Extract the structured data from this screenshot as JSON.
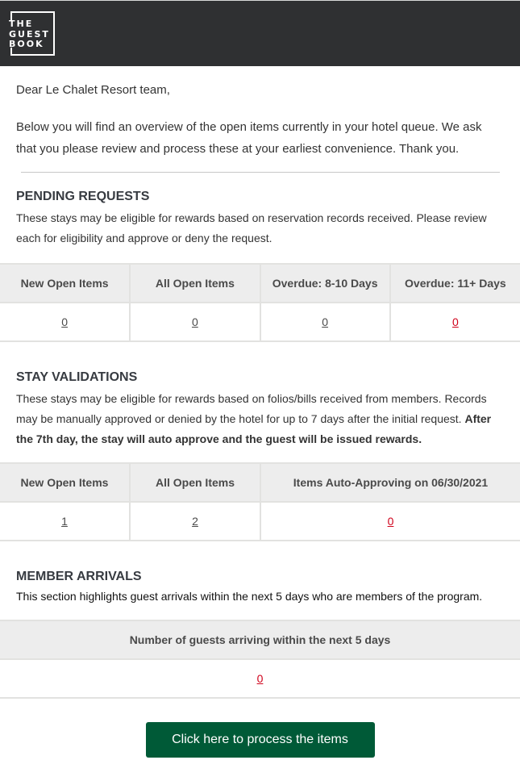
{
  "header": {
    "logo_lines": [
      "THE",
      "GUEST",
      "BOOK"
    ],
    "background": "#2f3032"
  },
  "letter": {
    "greeting": "Dear Le Chalet Resort team,",
    "intro": "Below you will find an overview of the open items currently in your hotel queue. We ask that you please review and process these at your earliest convenience. Thank you."
  },
  "pending_requests": {
    "title": "PENDING REQUESTS",
    "description": "These stays may be eligible for rewards based on reservation records received. Please review each for eligibility and approve or deny the request.",
    "columns": [
      "New Open Items",
      "All Open Items",
      "Overdue: 8-10 Days",
      "Overdue: 11+ Days"
    ],
    "values": [
      "0",
      "0",
      "0",
      "0"
    ]
  },
  "stay_validations": {
    "title": "STAY VALIDATIONS",
    "description": "These stays may be eligible for rewards based on folios/bills received from members. Records may be manually approved or denied by the hotel for up to 7 days after the initial request. ",
    "description_bold": "After the 7th day, the stay will auto approve and the guest will be issued rewards.",
    "columns": [
      "New Open Items",
      "All Open Items",
      "Items Auto-Approving on 06/30/2021"
    ],
    "values": [
      "1",
      "2",
      "0"
    ]
  },
  "member_arrivals": {
    "title": "MEMBER ARRIVALS",
    "description": "This section highlights guest arrivals within the next 5 days who are members of the program.",
    "columns": [
      "Number of guests arriving within the next 5 days"
    ],
    "values": [
      "0"
    ]
  },
  "cta": {
    "label": "Click here to process the items",
    "color": "#005a37"
  },
  "colors": {
    "alert": "#d0021b",
    "link": "#4a4a4a",
    "table_header_bg": "#ededed"
  }
}
